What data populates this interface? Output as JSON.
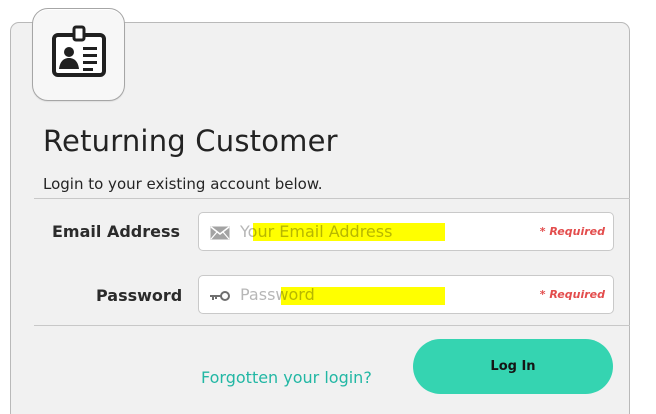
{
  "login": {
    "title": "Returning Customer",
    "subtitle": "Login to your existing account below.",
    "email": {
      "label": "Email Address",
      "placeholder": "Your Email Address",
      "value": "",
      "required": "* Required",
      "icon": "mail-icon"
    },
    "password": {
      "label": "Password",
      "placeholder": "Password",
      "value": "",
      "required": "* Required",
      "icon": "key-icon"
    },
    "forgot_link": "Forgotten your login?",
    "button_label": "Log In",
    "icon": "id-card-icon",
    "colors": {
      "accent": "#35d4b1",
      "link": "#22b7a4",
      "required": "#e34d4d",
      "highlight": "#ffff00",
      "panel": "#f1f1f1"
    }
  }
}
